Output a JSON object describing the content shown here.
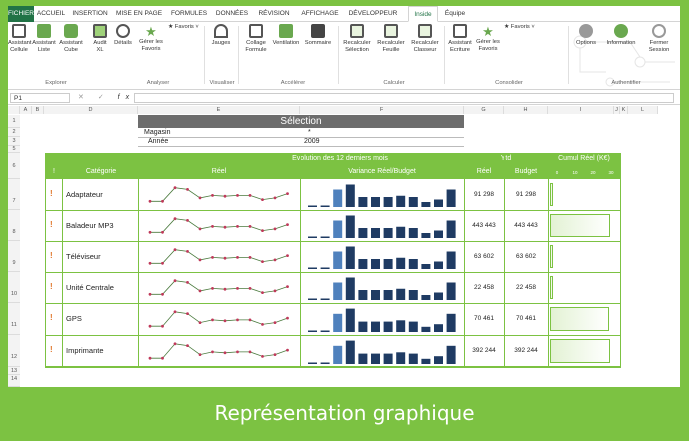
{
  "tabs": [
    {
      "label": "FICHIER",
      "active": false
    },
    {
      "label": "ACCUEIL"
    },
    {
      "label": "INSERTION"
    },
    {
      "label": "MISE EN PAGE"
    },
    {
      "label": "FORMULES"
    },
    {
      "label": "DONNÉES"
    },
    {
      "label": "RÉVISION"
    },
    {
      "label": "AFFICHAGE"
    },
    {
      "label": "DÉVELOPPEUR"
    },
    {
      "label": "Inside",
      "active": true
    },
    {
      "label": "Équipe"
    }
  ],
  "ribbon": {
    "buttons": [
      {
        "label": "Assistant\nCellule",
        "icon": "grid-icon"
      },
      {
        "label": "Assistant\nListe",
        "icon": "list-icon"
      },
      {
        "label": "Assistant\nCube",
        "icon": "cube-icon"
      },
      {
        "label": "Audit\nXL",
        "icon": "audit-icon"
      },
      {
        "label": "Détails",
        "icon": "search-icon"
      },
      {
        "label": "Gérer les\nFavoris",
        "icon": "star-icon"
      },
      {
        "label": "★ Favoris ˅",
        "icon": "favorites-icon"
      },
      {
        "label": "Jauges",
        "icon": "gauge-icon"
      },
      {
        "label": "Collage\nFormule",
        "icon": "paste-icon"
      },
      {
        "label": "Ventilation",
        "icon": "ventilation-icon"
      },
      {
        "label": "Sommaire",
        "icon": "book-icon"
      },
      {
        "label": "Recalculer\nSélection",
        "icon": "recalc-selection-icon"
      },
      {
        "label": "Recalculer\nFeuille",
        "icon": "recalc-sheet-icon"
      },
      {
        "label": "Recalculer\nClasseur",
        "icon": "recalc-workbook-icon"
      },
      {
        "label": "Assistant\nEcriture",
        "icon": "write-icon"
      },
      {
        "label": "Gérer les\nFavoris",
        "icon": "star-icon"
      },
      {
        "label": "★ Favoris ˅",
        "icon": "favorites-icon"
      },
      {
        "label": "Options",
        "icon": "wrench-icon"
      },
      {
        "label": "Information",
        "icon": "info-icon"
      },
      {
        "label": "Fermer\nSession",
        "icon": "key-icon"
      }
    ],
    "groups": [
      "Explorer",
      "Analyser",
      "Visualiser",
      "Accélérer",
      "Calculer",
      "Consolider",
      "Authentifier"
    ]
  },
  "formula_bar": {
    "name_box": "P1",
    "fx": "fx",
    "cancel": "✕",
    "confirm": "✓"
  },
  "columns": [
    "A",
    "B",
    "D",
    "E",
    "F",
    "G",
    "H",
    "I",
    "J",
    "K",
    "L"
  ],
  "rows": [
    "1",
    "2",
    "3",
    "5",
    "6",
    "7",
    "8",
    "9",
    "10",
    "11",
    "12",
    "13",
    "14"
  ],
  "selection": {
    "title": "Sélection",
    "magasin_label": "Magasin",
    "magasin_value": "*",
    "annee_label": "Année",
    "annee_value": "2009"
  },
  "table": {
    "header_group": "Evolution des 12 derniers mois",
    "ytd_group": "Ytd",
    "cumul_group": "Cumul Réel (K€)",
    "col_excl": "!",
    "col_categorie": "Catégorie",
    "col_reel": "Réel",
    "col_variance": "Variance Réel/Budget",
    "col_ytd_reel": "Réel",
    "col_ytd_budget": "Budget",
    "cumul_ticks": [
      "0",
      "10",
      "20",
      "30"
    ],
    "rows": [
      {
        "categorie": "Adaptateur",
        "reel": "91 298",
        "budget": "91 298",
        "cumul": 0.04
      },
      {
        "categorie": "Baladeur MP3",
        "reel": "443 443",
        "budget": "443 443",
        "cumul": 0.96
      },
      {
        "categorie": "Téléviseur",
        "reel": "63 602",
        "budget": "63 602",
        "cumul": 0.03
      },
      {
        "categorie": "Unité Centrale",
        "reel": "22 458",
        "budget": "22 458",
        "cumul": 0.02
      },
      {
        "categorie": "GPS",
        "reel": "70 461",
        "budget": "70 461",
        "cumul": 0.95
      },
      {
        "categorie": "Imprimante",
        "reel": "392 244",
        "budget": "392 244",
        "cumul": 0.96
      }
    ]
  },
  "footer": "Représentation graphique",
  "colors": {
    "accent": "#7cc242",
    "file_tab": "#217346",
    "bar": "#1f3b63",
    "bar_highlight": "#4f81bd",
    "spark": "#c0395a"
  }
}
